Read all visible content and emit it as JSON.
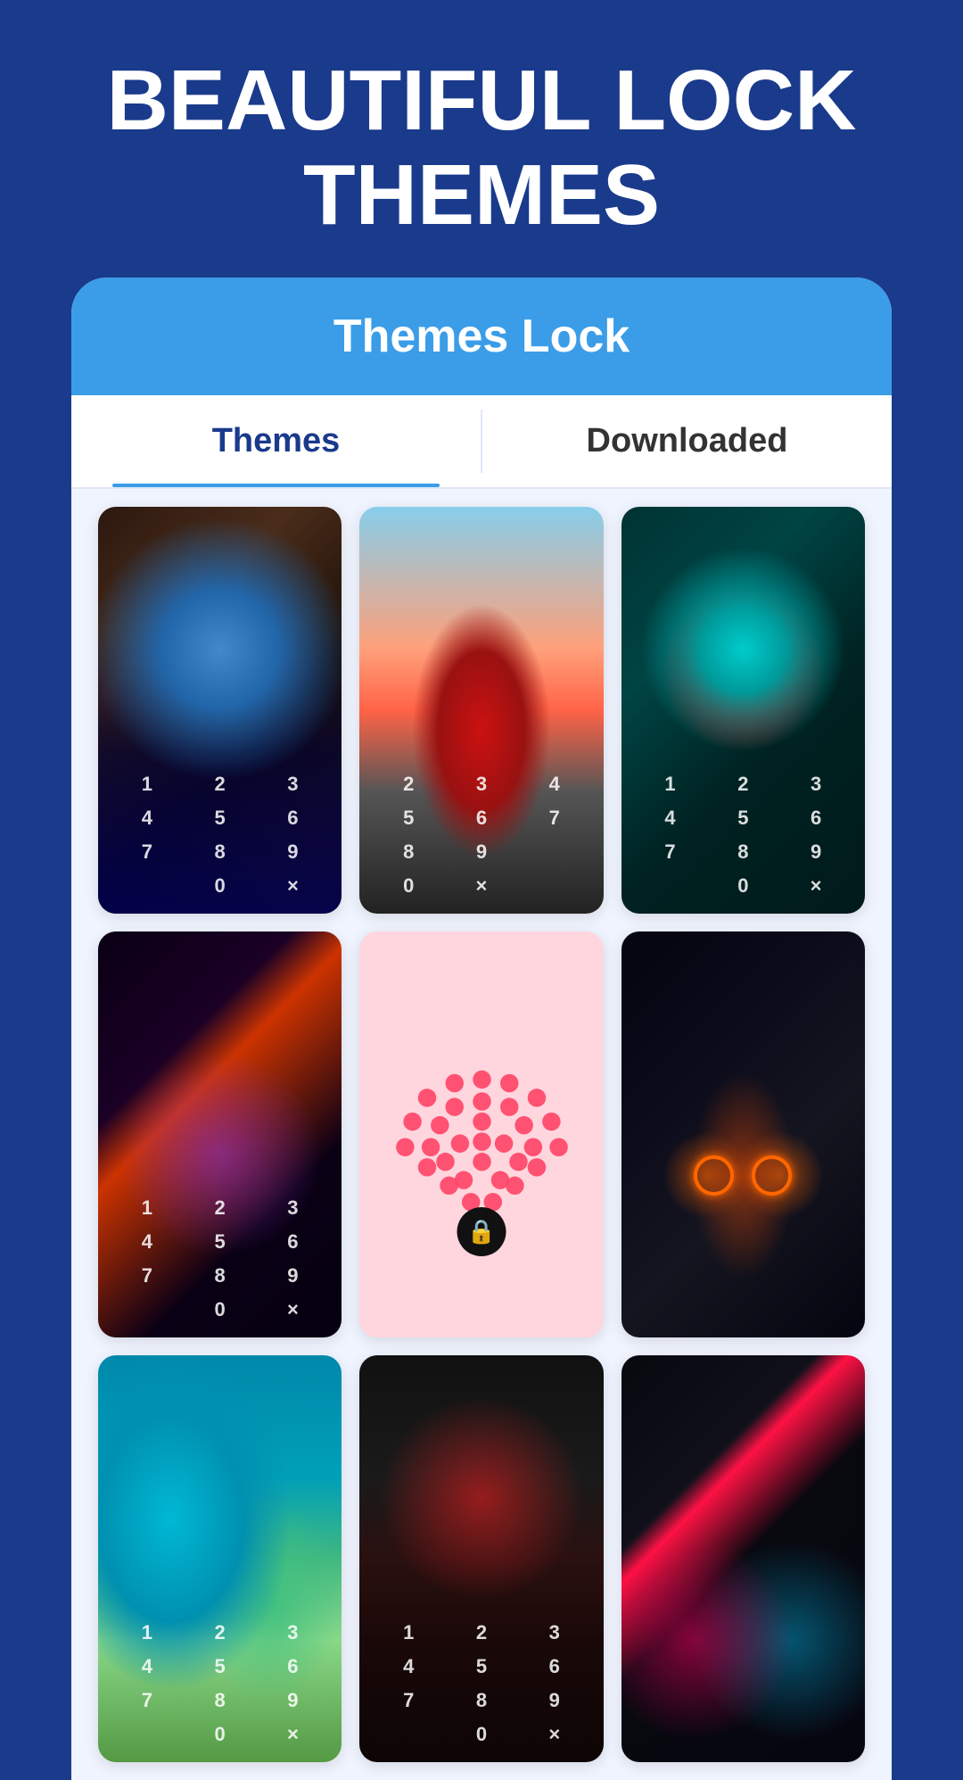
{
  "hero": {
    "title": "BEAUTIFUL LOCK THEMES"
  },
  "app": {
    "header": {
      "title": "Themes Lock"
    },
    "tabs": [
      {
        "id": "themes",
        "label": "Themes",
        "active": true
      },
      {
        "id": "downloaded",
        "label": "Downloaded",
        "active": false
      }
    ],
    "themes": [
      {
        "id": 1,
        "bg_class": "char-blue-mask",
        "has_keypad": true
      },
      {
        "id": 2,
        "bg_class": "char-red-car",
        "has_keypad": true
      },
      {
        "id": 3,
        "bg_class": "char-spiderman",
        "has_keypad": true
      },
      {
        "id": 4,
        "bg_class": "char-neon",
        "has_keypad": true
      },
      {
        "id": 5,
        "bg_class": "char-pink",
        "has_keypad": false,
        "special": "heart"
      },
      {
        "id": 6,
        "bg_class": "char-dark-car",
        "has_keypad": false
      },
      {
        "id": 7,
        "bg_class": "char-aerial",
        "has_keypad": true
      },
      {
        "id": 8,
        "bg_class": "char-joker",
        "has_keypad": true
      },
      {
        "id": 9,
        "bg_class": "char-neon-city",
        "has_keypad": false
      }
    ],
    "keypad_keys": [
      "1",
      "2",
      "3",
      "4",
      "5",
      "6",
      "7",
      "8",
      "9",
      "0",
      "×"
    ]
  }
}
